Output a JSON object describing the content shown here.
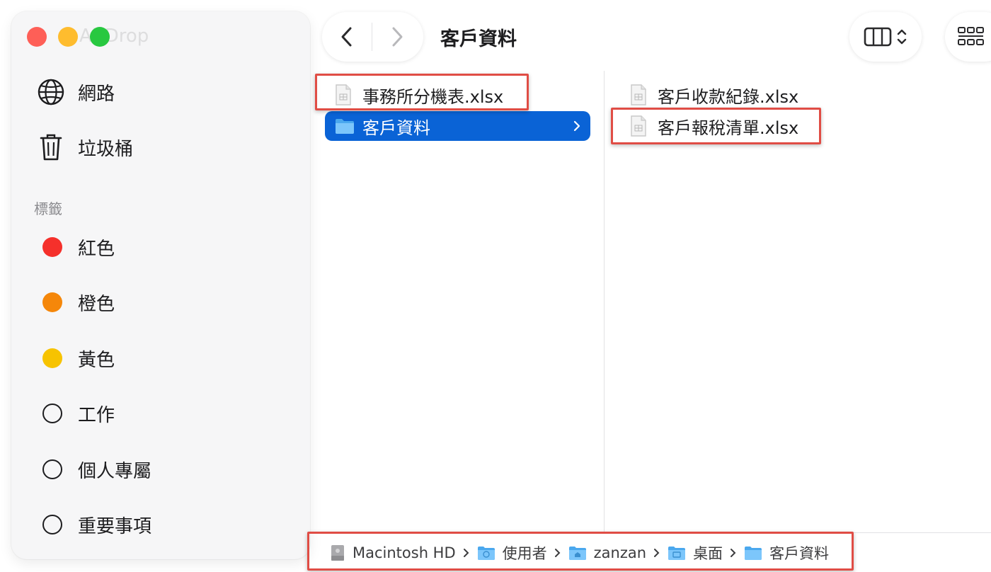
{
  "window": {
    "title": "客戶資料",
    "airdrop_label": "AirDrop"
  },
  "sidebar": {
    "items": [
      {
        "label": "網路",
        "icon": "globe-icon"
      },
      {
        "label": "垃圾桶",
        "icon": "trash-icon"
      }
    ],
    "tags_heading": "標籤",
    "tags": [
      {
        "label": "紅色",
        "color": "#f5302b"
      },
      {
        "label": "橙色",
        "color": "#f5870a"
      },
      {
        "label": "黃色",
        "color": "#f7c300"
      },
      {
        "label": "工作",
        "color": ""
      },
      {
        "label": "個人專屬",
        "color": ""
      },
      {
        "label": "重要事項",
        "color": ""
      }
    ]
  },
  "columns": {
    "first": [
      {
        "name": "事務所分機表.xlsx",
        "kind": "file"
      },
      {
        "name": "客戶資料",
        "kind": "folder",
        "selected": true
      }
    ],
    "second": [
      {
        "name": "客戶收款紀錄.xlsx",
        "kind": "file"
      },
      {
        "name": "客戶報稅清單.xlsx",
        "kind": "file"
      }
    ]
  },
  "pathbar": [
    "Macintosh HD",
    "使用者",
    "zanzan",
    "桌面",
    "客戶資料"
  ],
  "colors": {
    "selection": "#0a63d6",
    "highlight": "#e04d45",
    "folder": "#5bb8f5"
  }
}
